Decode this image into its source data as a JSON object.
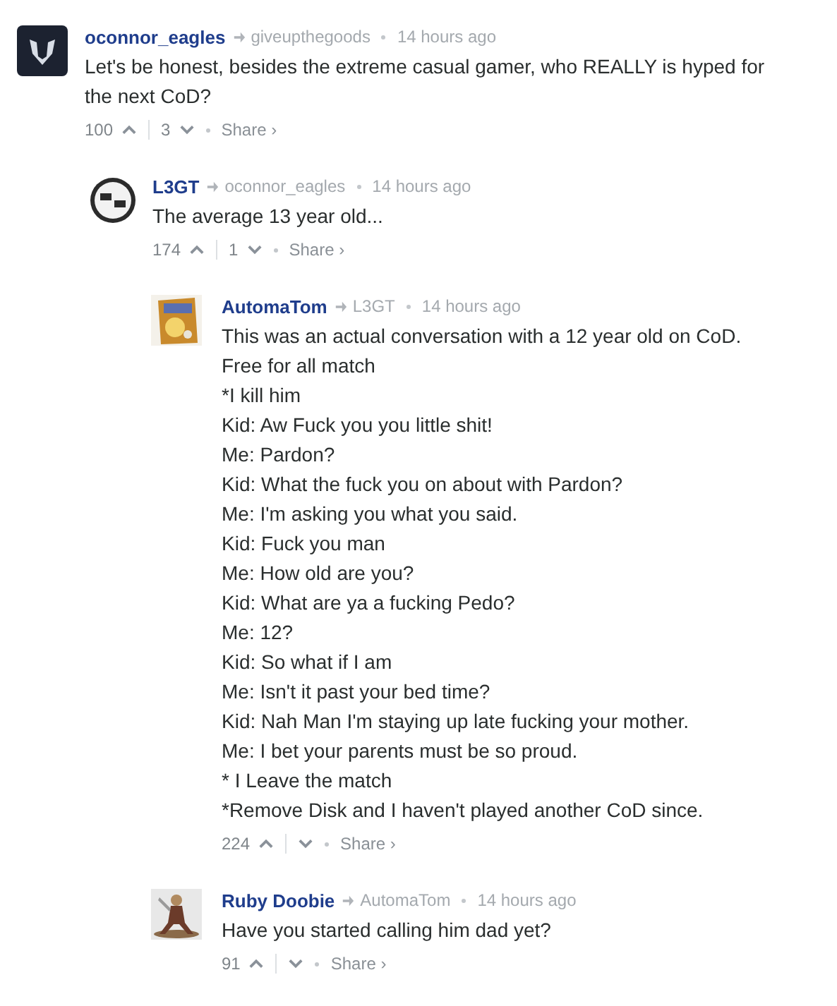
{
  "comments": [
    {
      "avatar": {
        "kind": "dark-logo"
      },
      "author": "oconnor_eagles",
      "reply_to": "giveupthegoods",
      "time": "14 hours ago",
      "lines": [
        "Let's be honest, besides the extreme casual gamer, who REALLY is hyped for the next CoD?"
      ],
      "upvotes": "100",
      "downvotes": "3",
      "share": "Share ›",
      "children": [
        {
          "avatar": {
            "kind": "round-logo"
          },
          "author": "L3GT",
          "reply_to": "oconnor_eagles",
          "time": "14 hours ago",
          "lines": [
            "The average 13 year old..."
          ],
          "upvotes": "174",
          "downvotes": "1",
          "share": "Share ›",
          "children": [
            {
              "avatar": {
                "kind": "snack"
              },
              "author": "AutomaTom",
              "reply_to": "L3GT",
              "time": "14 hours ago",
              "lines": [
                "This was an actual conversation with a 12 year old on CoD.",
                "Free for all match",
                "*I kill him",
                "Kid: Aw Fuck you you little shit!",
                "Me: Pardon?",
                "Kid: What the fuck you on about with Pardon?",
                "Me: I'm asking you what you said.",
                "Kid: Fuck you man",
                "Me: How old are you?",
                "Kid: What are ya a fucking Pedo?",
                "Me: 12?",
                "Kid: So what if I am",
                "Me: Isn't it past your bed time?",
                "Kid: Nah Man I'm staying up late fucking your mother.",
                "Me: I bet your parents must be so proud.",
                "* I Leave the match",
                "*Remove Disk and I haven't played another CoD since."
              ],
              "upvotes": "224",
              "share": "Share ›"
            },
            {
              "avatar": {
                "kind": "figure"
              },
              "author": "Ruby Doobie",
              "reply_to": "AutomaTom",
              "time": "14 hours ago",
              "lines": [
                "Have you started calling him dad yet?"
              ],
              "upvotes": "91",
              "share": "Share ›"
            }
          ]
        }
      ]
    }
  ]
}
